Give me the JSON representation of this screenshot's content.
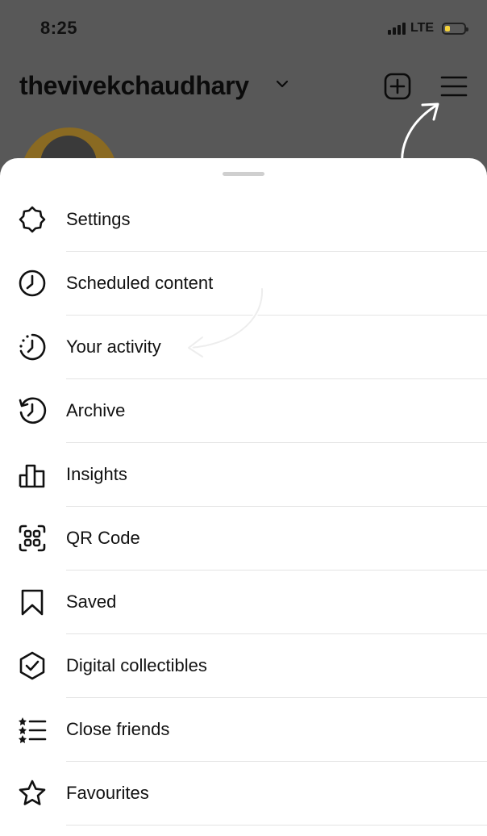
{
  "status_bar": {
    "time": "8:25",
    "network": "LTE"
  },
  "header": {
    "username": "thevivekchaudhary"
  },
  "menu": {
    "items": [
      {
        "label": "Settings",
        "icon": "settings-icon"
      },
      {
        "label": "Scheduled content",
        "icon": "clock-icon"
      },
      {
        "label": "Your activity",
        "icon": "activity-icon"
      },
      {
        "label": "Archive",
        "icon": "archive-icon"
      },
      {
        "label": "Insights",
        "icon": "insights-icon"
      },
      {
        "label": "QR Code",
        "icon": "qr-code-icon"
      },
      {
        "label": "Saved",
        "icon": "bookmark-icon"
      },
      {
        "label": "Digital collectibles",
        "icon": "collectibles-icon"
      },
      {
        "label": "Close friends",
        "icon": "close-friends-icon"
      },
      {
        "label": "Favourites",
        "icon": "star-icon"
      }
    ]
  },
  "colors": {
    "overlay": "#585858",
    "sheet": "#ffffff",
    "battery": "#f4d23b"
  }
}
